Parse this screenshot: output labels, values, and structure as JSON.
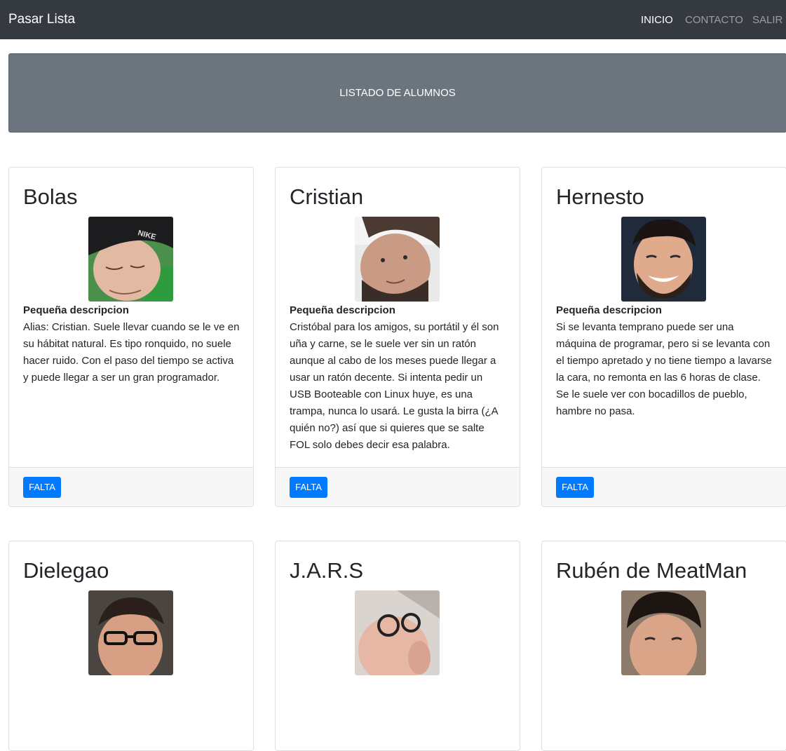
{
  "navbar": {
    "brand": "Pasar Lista",
    "links": [
      "INICIO",
      "CONTACTO",
      "SALIR"
    ]
  },
  "header": {
    "title": "LISTADO DE ALUMNOS"
  },
  "cards": [
    {
      "name": "Bolas",
      "desc_title": "Pequeña descripcion",
      "desc": "Alias: Cristian. Suele llevar cuando se le ve en su hábitat natural. Es tipo ronquido, no suele hacer ruido. Con el paso del tiempo se activa y puede llegar a ser un gran programador.",
      "button": "FALTA"
    },
    {
      "name": "Cristian",
      "desc_title": "Pequeña descripcion",
      "desc": "Cristóbal para los amigos, su portátil y él son uña y carne, se le suele ver sin un ratón aunque al cabo de los meses puede llegar a usar un ratón decente. Si intenta pedir un USB Booteable con Linux huye, es una trampa, nunca lo usará. Le gusta la birra (¿A quién no?) así que si quieres que se salte FOL solo debes decir esa palabra.",
      "button": "FALTA"
    },
    {
      "name": "Hernesto",
      "desc_title": "Pequeña descripcion",
      "desc": "Si se levanta temprano puede ser una máquina de programar, pero si se levanta con el tiempo apretado y no tiene tiempo a lavarse la cara, no remonta en las 6 horas de clase. Se le suele ver con bocadillos de pueblo, hambre no pasa.",
      "button": "FALTA"
    },
    {
      "name": "Dielegao"
    },
    {
      "name": "J.A.R.S"
    },
    {
      "name": "Rubén de MeatMan"
    }
  ]
}
